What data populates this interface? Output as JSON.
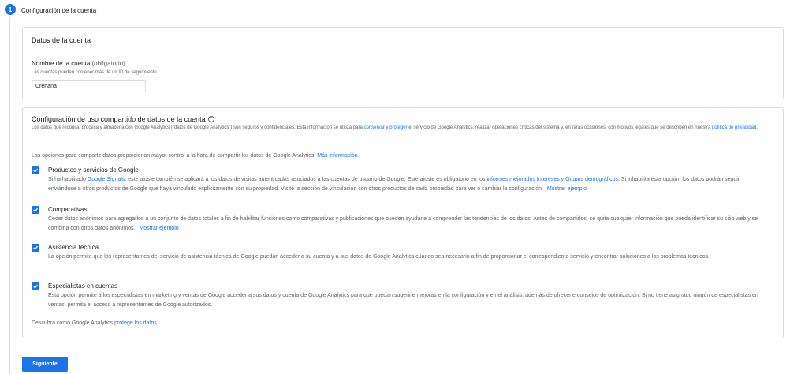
{
  "step": {
    "number": "1",
    "title": "Configuración de la cuenta"
  },
  "account_card": {
    "header": "Datos de la cuenta",
    "field_label": "Nombre de la cuenta",
    "field_optional": "(obligatorio)",
    "field_help": "Las cuentas pueden contener más de un ID de seguimiento.",
    "field_value": "Crehana"
  },
  "sharing_card": {
    "title": "Configuración de uso compartido de datos de la cuenta",
    "help_icon": "?",
    "desc_1": "Los datos que recopila, procesa y almacena con Google Analytics (\"datos de Google Analytics\") son seguros y confidenciales. Esta información se utiliza para",
    "desc_link_1": "conservar y proteger",
    "desc_2": "el servicio de Google Analytics, realizar operaciones críticas del sistema y, en raras ocasiones, con motivos legales que se describen en nuestra",
    "desc_link_2": "política de privacidad",
    "desc_3": ".",
    "intro": "Las opciones para compartir datos proporcionan mayor control a la hora de compartir los datos de Google Analytics.",
    "intro_link": "Más información",
    "options": [
      {
        "title": "Productos y servicios de Google",
        "desc_a": "Si ha habilitado",
        "link_a": "Google Signals",
        "desc_b": ", este ajuste también se aplicará a los datos de visitas autenticadas asociados a las cuentas de usuario de Google. Este ajuste es obligatorio en los",
        "link_b": "informes mejorados Intereses y Grupos demográficos",
        "desc_c": ". Si inhabilita esta opción, los datos podrán seguir enviándose a otros productos de Google que haya vinculado explícitamente con su propiedad. Visite la sección de vinculación con otros productos de cada propiedad para ver o cambiar la configuración.",
        "link_c": "Mostrar ejemplo"
      },
      {
        "title": "Comparativas",
        "desc": "Ceder datos anónimos para agregarlos a un conjunto de datos totales a fin de habilitar funciones como comparativas y publicaciones que pueden ayudarle a comprender las tendencias de los datos. Antes de compartirlos, se quita cualquier información que pueda identificar su sitio web y se combina con otros datos anónimos.",
        "link": "Mostrar ejemplo"
      },
      {
        "title": "Asistencia técnica",
        "desc": "La opción permite que los representantes del servicio de asistencia técnica de Google puedan acceder a su cuenta y a sus datos de Google Analytics cuando sea necesario a fin de proporcionar el correspondiente servicio y encontrar soluciones a los problemas técnicos."
      },
      {
        "title": "Especialistas en cuentas",
        "desc": "Esta opción permite a los especialistas en marketing y ventas de Google acceder a sus datos y cuenta de Google Analytics para que puedan sugerirle mejoras en la configuración y en el análisis, además de ofrecerle consejos de optimización. Si no tiene asignado ningún de especialistas en ventas, permita el acceso a representantes de Google autorizados."
      }
    ],
    "footer_text": "Descubra cómo Google Analytics",
    "footer_link": "protege los datos",
    "footer_end": "."
  },
  "next_button": "Siguiente",
  "colors": {
    "accent": "#1a73e8",
    "border": "#dadce0",
    "text": "#202124",
    "muted": "#5f6368"
  },
  "icons": {
    "checkbox": "check-icon",
    "help": "help-circle-icon"
  }
}
